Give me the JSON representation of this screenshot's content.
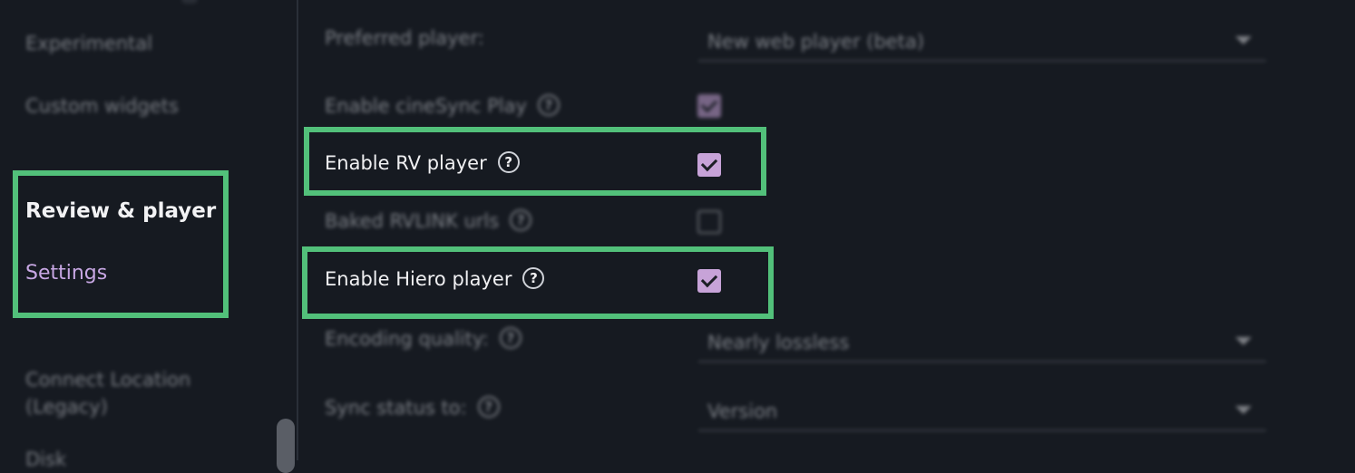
{
  "sidebar": {
    "items_above": [
      "Experimental",
      "Custom widgets"
    ],
    "section_heading": "Review & player",
    "active_item": "Settings",
    "items_below": [
      "Connect Location",
      "(Legacy)",
      "Disk"
    ]
  },
  "settings": {
    "preferred_player": {
      "label": "Preferred player:",
      "value": "New web player (beta)"
    },
    "enable_cinesync": {
      "label": "Enable cineSync Play",
      "checked": true
    },
    "enable_rv": {
      "label": "Enable RV player",
      "checked": true
    },
    "baked_rvlink": {
      "label": "Baked RVLINK urls",
      "checked": false
    },
    "enable_hiero": {
      "label": "Enable Hiero player",
      "checked": true
    },
    "encoding_quality": {
      "label": "Encoding quality:",
      "value": "Nearly lossless"
    },
    "sync_status": {
      "label": "Sync status to:",
      "value": "Version"
    }
  },
  "help_glyph": "?",
  "colors": {
    "highlight": "#52c07a",
    "accent": "#c7a7e3",
    "background": "#161a21"
  }
}
